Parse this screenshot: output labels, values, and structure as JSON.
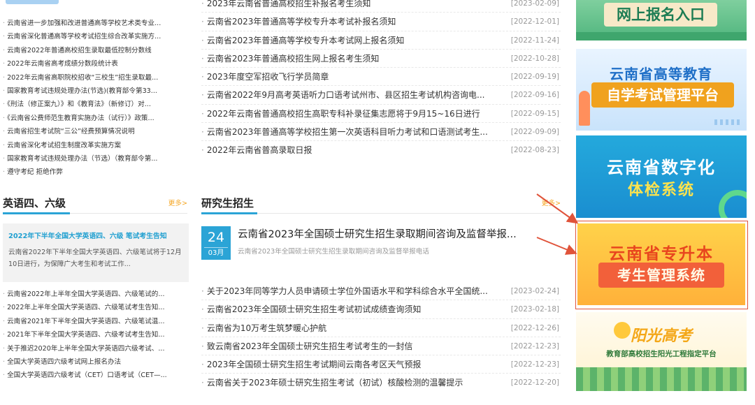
{
  "left_news": [
    "云南省进一步加强和改进普通高等学校艺术类专业...",
    "云南省深化普通高等学校考试招生综合改革实施方...",
    "云南省2022年普通高校招生录取最低控制分数线",
    "2022年云南省高考成绩分数段统计表",
    "2022年云南省高职院校招收“三校生”招生录取最...",
    "国家教育考试违规处理办法(节选)(教育部令第33...",
    "《刑法（修正案九）》和《教育法》（新修订）对...",
    "《云南省公费师范生教育实施办法（试行）》政策...",
    "云南省招生考试院“三公”经费预算情况说明",
    "云南省深化考试招生制度改革实施方案",
    "国家教育考试违规处理办法（节选）（教育部令第...",
    "遵守考纪 拒绝作弊"
  ],
  "middle_news": [
    {
      "title": "2023年云南省普通高校招生补报名考生须知",
      "date": "[2023-02-09]"
    },
    {
      "title": "云南省2023年普通高等学校专升本考试补报名须知",
      "date": "[2022-12-01]"
    },
    {
      "title": "云南省2023年普通高等学校专升本考试网上报名须知",
      "date": "[2022-11-24]"
    },
    {
      "title": "云南省2023年普通高校招生网上报名考生须知",
      "date": "[2022-10-28]"
    },
    {
      "title": "2023年度空军招收飞行学员简章",
      "date": "[2022-09-19]"
    },
    {
      "title": "云南省2022年9月高考英语听力口语考试州市、县区招生考试机构咨询电...",
      "date": "[2022-09-16]"
    },
    {
      "title": "2022年云南省普通高校招生高职专科补录征集志愿将于9月15~16日进行",
      "date": "[2022-09-15]"
    },
    {
      "title": "云南省2023年普通高等学校招生第一次英语科目听力考试和口语测试考生...",
      "date": "[2022-09-09]"
    },
    {
      "title": "2022年云南省普高录取日报",
      "date": "[2022-08-23]"
    }
  ],
  "cet": {
    "title": "英语四、六级",
    "more": "更多>",
    "featured_title": "2022年下半年全国大学英语四、六级 笔试考生告知",
    "featured_desc": "云南省2022年下半年全国大学英语四、六级笔试将于12月10日进行，为保障广大考生和考试工作...",
    "items": [
      "云南省2022年上半年全国大学英语四、六级笔试的...",
      "2022年上半年全国大学英语四、六级笔试考生告知...",
      "云南省2021年下半年全国大学英语四、六级笔试温...",
      "2021年下半年全国大学英语四、六级考试考生告知...",
      "关于推迟2020年上半年全国大学英语四六级考试、...",
      "全国大学英语四六级考试网上报名办法",
      "全国大学英语四六级考试（CET）口语考试（CET—..."
    ]
  },
  "grad": {
    "title": "研究生招生",
    "more": "更多>",
    "featured_day": "24",
    "featured_month": "03月",
    "featured_title": "云南省2023年全国硕士研究生招生录取期间咨询及监督举报...",
    "featured_sub": "云南省2023年全国硕士研究生招生录取期间咨询及监督举报电话",
    "items": [
      {
        "title": "关于2023年同等学力人员申请硕士学位外国语水平和学科综合水平全国统...",
        "date": "[2023-02-24]"
      },
      {
        "title": "云南省2023年全国硕士研究生招生考试初试成绩查询须知",
        "date": "[2023-02-18]"
      },
      {
        "title": "云南省为10万考生筑梦暖心护航",
        "date": "[2022-12-26]"
      },
      {
        "title": "致云南省2023年全国硕士研究生招生考试考生的一封信",
        "date": "[2022-12-23]"
      },
      {
        "title": "2023年全国硕士研究生招生考试期间云南各考区天气预报",
        "date": "[2022-12-23]"
      },
      {
        "title": "云南省关于2023年硕士研究生招生考试（初试）核酸检测的温馨提示",
        "date": "[2022-12-20]"
      }
    ]
  },
  "banners": {
    "signup": "网上报名入口",
    "self_study_line1": "云南省高等教育",
    "self_study_line2": "自学考试管理平台",
    "health_line1": "云南省数字化",
    "health_line2": "体检系统",
    "zsb_line1": "云南省专升本",
    "zsb_line2": "考生管理系统",
    "sunshine_title": "阳光高考",
    "sunshine_sub": "教育部高校招生阳光工程指定平台"
  },
  "colors": {
    "accent": "#2ba4d6",
    "more": "#f5a623",
    "arrow": "#e0533a"
  }
}
